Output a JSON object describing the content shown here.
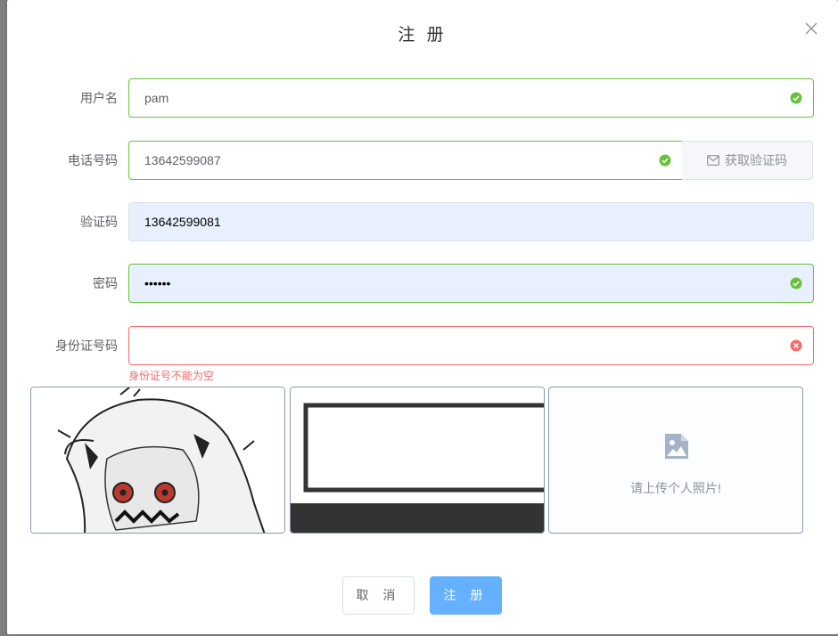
{
  "dialog": {
    "title": "注 册",
    "close_icon": "close-icon"
  },
  "form": {
    "username": {
      "label": "用户名",
      "value": "pam",
      "status": "valid"
    },
    "phone": {
      "label": "电话号码",
      "value": "13642599087",
      "status": "valid",
      "append_label": "获取验证码",
      "append_icon": "mail-icon"
    },
    "code": {
      "label": "验证码",
      "value": "13642599081"
    },
    "password": {
      "label": "密码",
      "value": "••••••",
      "status": "valid"
    },
    "id_number": {
      "label": "身份证号码",
      "value": "",
      "status": "error",
      "error": "身份证号不能为空"
    }
  },
  "photos": {
    "upload_text": "请上传个人照片!",
    "upload_icon": "image-icon"
  },
  "buttons": {
    "cancel": "取 消",
    "submit": "注 册"
  },
  "colors": {
    "success": "#67c23a",
    "error": "#f56c6c",
    "primary_light": "#66b1ff",
    "autofill": "#e8f0fe"
  }
}
